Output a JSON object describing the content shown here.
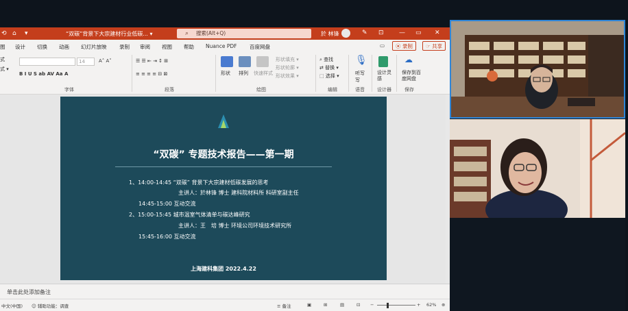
{
  "window": {
    "title": "“双碳”背景下大宗建材行业低碳... ▾",
    "search_placeholder": "搜索(Alt+Q)",
    "user": "於 林锋"
  },
  "tabs": [
    "设计",
    "切换",
    "动画",
    "幻灯片放映",
    "录制",
    "审阅",
    "视图",
    "帮助",
    "Nuance PDF",
    "百度网盘"
  ],
  "tab_left": "图",
  "record_btn": "⦿ 录制",
  "share_btn": "☞ 共享",
  "ribbon": {
    "groups": [
      "字体",
      "段落",
      "绘图",
      "编辑",
      "语音",
      "设计器",
      "保存"
    ],
    "font_size": "14",
    "buttons": {
      "shape": "形状",
      "arrange": "排列",
      "quick_style": "快速样式",
      "fill": "形状填充 ▾",
      "outline": "形状轮廓 ▾",
      "effect": "形状效果 ▾",
      "find": "查找",
      "replace": "替换 ▾",
      "select": "选择 ▾",
      "dictate": "听写",
      "dictate2": "写",
      "designer": "设计灵感",
      "baidu_save": "保存到百度网盘"
    },
    "left_frag1": "式",
    "left_frag2": "式 ▾"
  },
  "slide": {
    "title": "“双碳” 专题技术报告——第一期",
    "lines": [
      "1、14:00-14:45 “双碳” 背景下大宗建材低碳发展的思考",
      "主讲人：於林锋 博士 建科院材料所 科研室副主任",
      "14:45-15:00 互动交流",
      "2、15:00-15:45 城市温室气体清单与碳达峰研究",
      "主讲人：王　培 博士 环境公司环境技术研究所",
      "15:45-16:00 互动交流"
    ],
    "footer": "上海建科集团 2022.4.22"
  },
  "notes_placeholder": "单击此处添加备注",
  "status": {
    "lang": "中文(中国)",
    "accessibility": "辅助功能：调查",
    "notes_btn": "备注",
    "zoom": "62%"
  }
}
